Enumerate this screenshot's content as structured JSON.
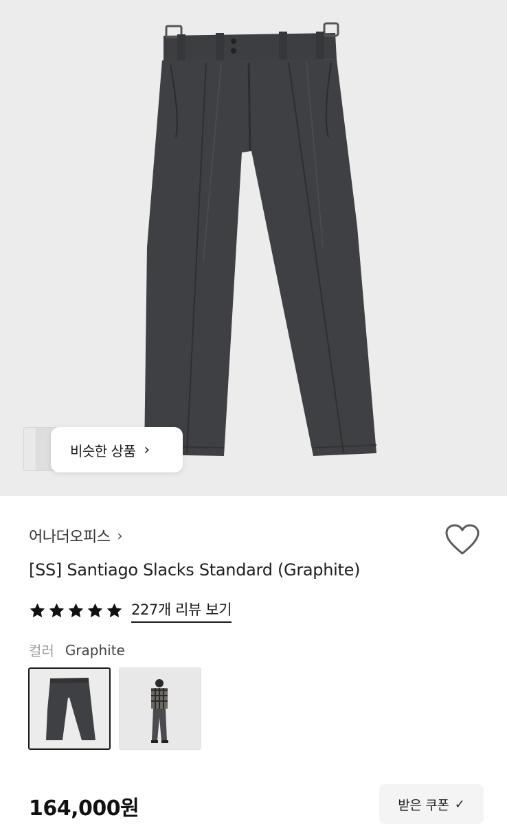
{
  "hero": {
    "image_alt": "Graphite pleated wide slacks",
    "similar_button": {
      "label": "비슷한 상품",
      "icon": "chevron-right-icon"
    }
  },
  "product": {
    "brand": "어나더오피스",
    "title": "[SS] Santiago Slacks Standard (Graphite)",
    "rating": {
      "stars": 5,
      "max": 5,
      "review_link": "227개 리뷰 보기"
    },
    "color": {
      "label": "컬러",
      "value": "Graphite"
    },
    "swatches": [
      {
        "name": "Graphite product",
        "selected": true
      },
      {
        "name": "Graphite model",
        "selected": false
      }
    ],
    "price": "164,000원",
    "coupon_button": "받은 쿠폰"
  },
  "colors": {
    "hero_bg": "#ececec",
    "pants": "#3f4043",
    "text": "#1a1a1a",
    "muted": "#9a9a9a"
  }
}
